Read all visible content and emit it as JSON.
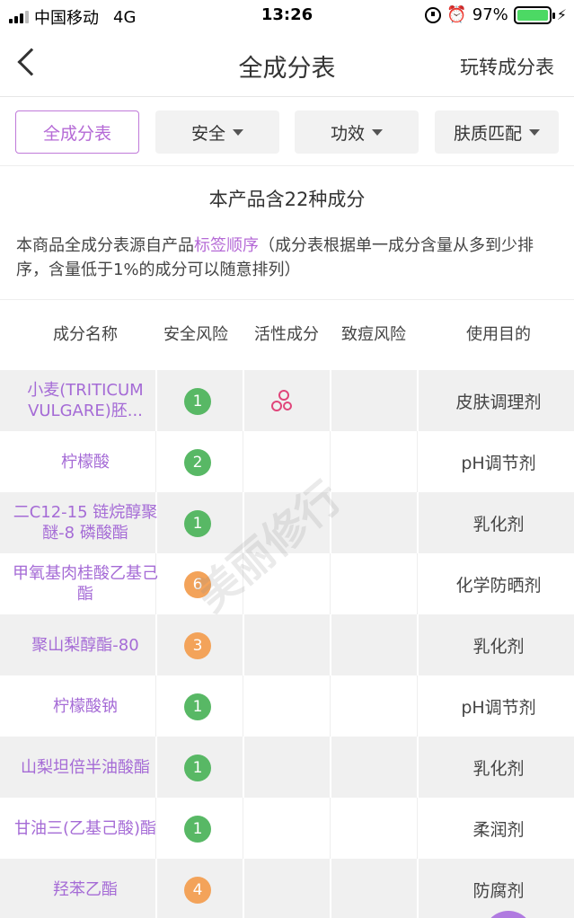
{
  "status": {
    "carrier": "中国移动",
    "network": "4G",
    "time": "13:26",
    "battery": "97%"
  },
  "nav": {
    "title": "全成分表",
    "right_link": "玩转成分表"
  },
  "filters": [
    {
      "label": "全成分表"
    },
    {
      "label": "安全"
    },
    {
      "label": "功效"
    },
    {
      "label": "肤质匹配"
    }
  ],
  "summary": "本产品含22种成分",
  "description": {
    "before": "本商品全成分表源自产品",
    "highlight": "标签顺序",
    "after": "（成分表根据单一成分含量从多到少排序，含量低于1%的成分可以随意排列）"
  },
  "table": {
    "headers": [
      "成分名称",
      "安全风险",
      "活性成分",
      "致痘风险",
      "使用目的"
    ],
    "rows": [
      {
        "name": "小麦(TRITICUM VULGARE)胚...",
        "score": "1",
        "level": "green",
        "active": true,
        "purpose": "皮肤调理剂"
      },
      {
        "name": "柠檬酸",
        "score": "2",
        "level": "green",
        "active": false,
        "purpose": "pH调节剂"
      },
      {
        "name": "二C12-15 链烷醇聚醚-8 磷酸酯",
        "score": "1",
        "level": "green",
        "active": false,
        "purpose": "乳化剂"
      },
      {
        "name": "甲氧基肉桂酸乙基己酯",
        "score": "6",
        "level": "orange",
        "active": false,
        "purpose": "化学防晒剂"
      },
      {
        "name": "聚山梨醇酯-80",
        "score": "3",
        "level": "orange",
        "active": false,
        "purpose": "乳化剂"
      },
      {
        "name": "柠檬酸钠",
        "score": "1",
        "level": "green",
        "active": false,
        "purpose": "pH调节剂"
      },
      {
        "name": "山梨坦倍半油酸酯",
        "score": "1",
        "level": "green",
        "active": false,
        "purpose": "乳化剂"
      },
      {
        "name": "甘油三(乙基己酸)酯",
        "score": "1",
        "level": "green",
        "active": false,
        "purpose": "柔润剂"
      },
      {
        "name": "羟苯乙酯",
        "score": "4",
        "level": "orange",
        "active": false,
        "purpose": "防腐剂"
      }
    ]
  },
  "watermark": "美丽修行",
  "colors": {
    "accent": "#b56ad6",
    "safe_green": "#58b865",
    "risk_orange": "#f3a35a"
  }
}
